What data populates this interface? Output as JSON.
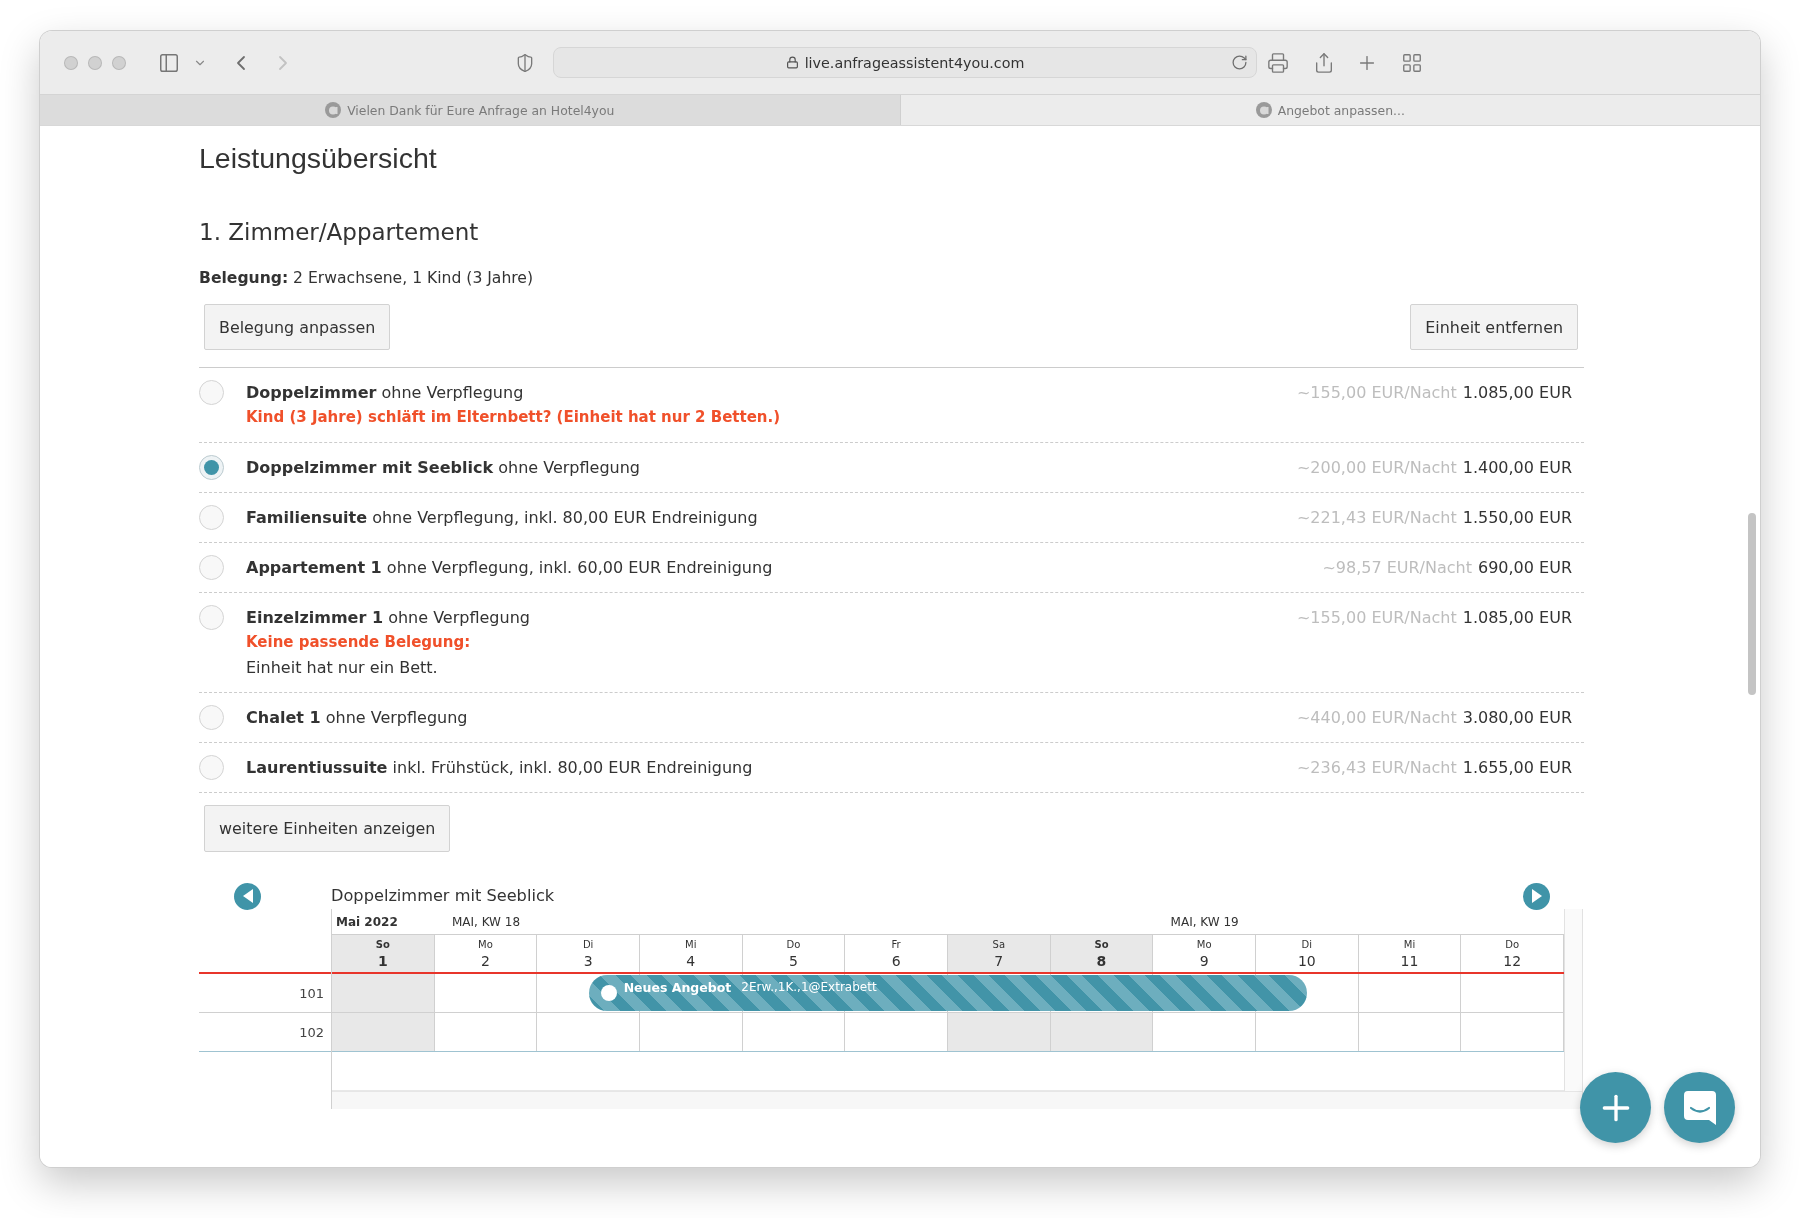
{
  "browser": {
    "focused": false,
    "back_disabled": false,
    "forward_disabled": true,
    "url": "live.anfrageassistent4you.com",
    "tabs": [
      {
        "title": "Vielen Dank für Eure Anfrage an Hotel4you",
        "selected": false
      },
      {
        "title": "Angebot anpassen...",
        "selected": true
      }
    ]
  },
  "page": {
    "title": "Leistungsübersicht"
  },
  "unit": {
    "heading": "1. Zimmer/Appartement",
    "occupancy": "**Belegung:** 2 Erwachsene, 1 Kind (3 Jahre)",
    "actions": [
      {
        "label": "Belegung anpassen"
      },
      {
        "label": "Einheit entfernen"
      }
    ],
    "options": [
      {
        "label": "**Doppelzimmer** ohne Verpflegung",
        "per_night": "~155,00 EUR/Nacht",
        "total": "1.085,00 EUR",
        "selected": false,
        "notes": [
          {
            "kind": "warning",
            "text": "Kind (3 Jahre) schläft im Elternbett? (Einheit hat nur 2 Betten.)"
          }
        ]
      },
      {
        "label": "**Doppelzimmer mit Seeblick** ohne Verpflegung",
        "per_night": "~200,00 EUR/Nacht",
        "total": "1.400,00 EUR",
        "selected": true
      },
      {
        "label": "**Familiensuite** ohne Verpflegung, inkl. 80,00 EUR Endreinigung",
        "per_night": "~221,43 EUR/Nacht",
        "total": "1.550,00 EUR",
        "selected": false
      },
      {
        "label": "**Appartement 1** ohne Verpflegung, inkl. 60,00 EUR Endreinigung",
        "per_night": "~98,57 EUR/Nacht",
        "total": "690,00 EUR",
        "selected": false
      },
      {
        "label": "**Einzelzimmer 1** ohne Verpflegung",
        "per_night": "~155,00 EUR/Nacht",
        "total": "1.085,00 EUR",
        "selected": false,
        "notes": [
          {
            "kind": "warning",
            "text": "Keine passende Belegung:"
          },
          {
            "kind": "info",
            "text": "Einheit hat nur ein Bett."
          }
        ]
      },
      {
        "label": "**Chalet 1** ohne Verpflegung",
        "per_night": "~440,00 EUR/Nacht",
        "total": "3.080,00 EUR",
        "selected": false
      },
      {
        "label": "**Laurentiussuite** inkl. Frühstück, inkl. 80,00 EUR Endreinigung",
        "per_night": "~236,43 EUR/Nacht",
        "total": "1.655,00 EUR",
        "selected": false
      }
    ],
    "more_button": "weitere Einheiten anzeigen"
  },
  "calendar": {
    "title": "Doppelzimmer mit Seeblick",
    "month": "Mai 2022",
    "days": [
      {
        "weekday": "So",
        "date": "1",
        "kind": "sunday"
      },
      {
        "weekday": "Mo",
        "date": "2",
        "kind": "weekday",
        "week_label": "MAI, KW 18"
      },
      {
        "weekday": "Di",
        "date": "3",
        "kind": "weekday"
      },
      {
        "weekday": "Mi",
        "date": "4",
        "kind": "weekday"
      },
      {
        "weekday": "Do",
        "date": "5",
        "kind": "weekday"
      },
      {
        "weekday": "Fr",
        "date": "6",
        "kind": "weekday"
      },
      {
        "weekday": "Sa",
        "date": "7",
        "kind": "saturday"
      },
      {
        "weekday": "So",
        "date": "8",
        "kind": "sunday"
      },
      {
        "weekday": "Mo",
        "date": "9",
        "kind": "weekday",
        "week_label": "MAI, KW 19"
      },
      {
        "weekday": "Di",
        "date": "10",
        "kind": "weekday"
      },
      {
        "weekday": "Mi",
        "date": "11",
        "kind": "weekday"
      },
      {
        "weekday": "Do",
        "date": "12",
        "kind": "weekday"
      }
    ],
    "rooms": [
      {
        "number": "101",
        "offer": {
          "title": "Neues Angebot",
          "details": "2Erw.,1K.,1@Extrabett",
          "span": [
            {
              "kind": "free"
            },
            {
              "kind": "free"
            },
            {
              "kind": "arrival"
            },
            {
              "kind": "stay"
            },
            {
              "kind": "stay"
            },
            {
              "kind": "stay"
            },
            {
              "kind": "stay"
            },
            {
              "kind": "stay"
            },
            {
              "kind": "stay"
            },
            {
              "kind": "departure"
            },
            {
              "kind": "free"
            },
            {
              "kind": "free"
            }
          ]
        }
      },
      {
        "number": "102"
      }
    ]
  }
}
